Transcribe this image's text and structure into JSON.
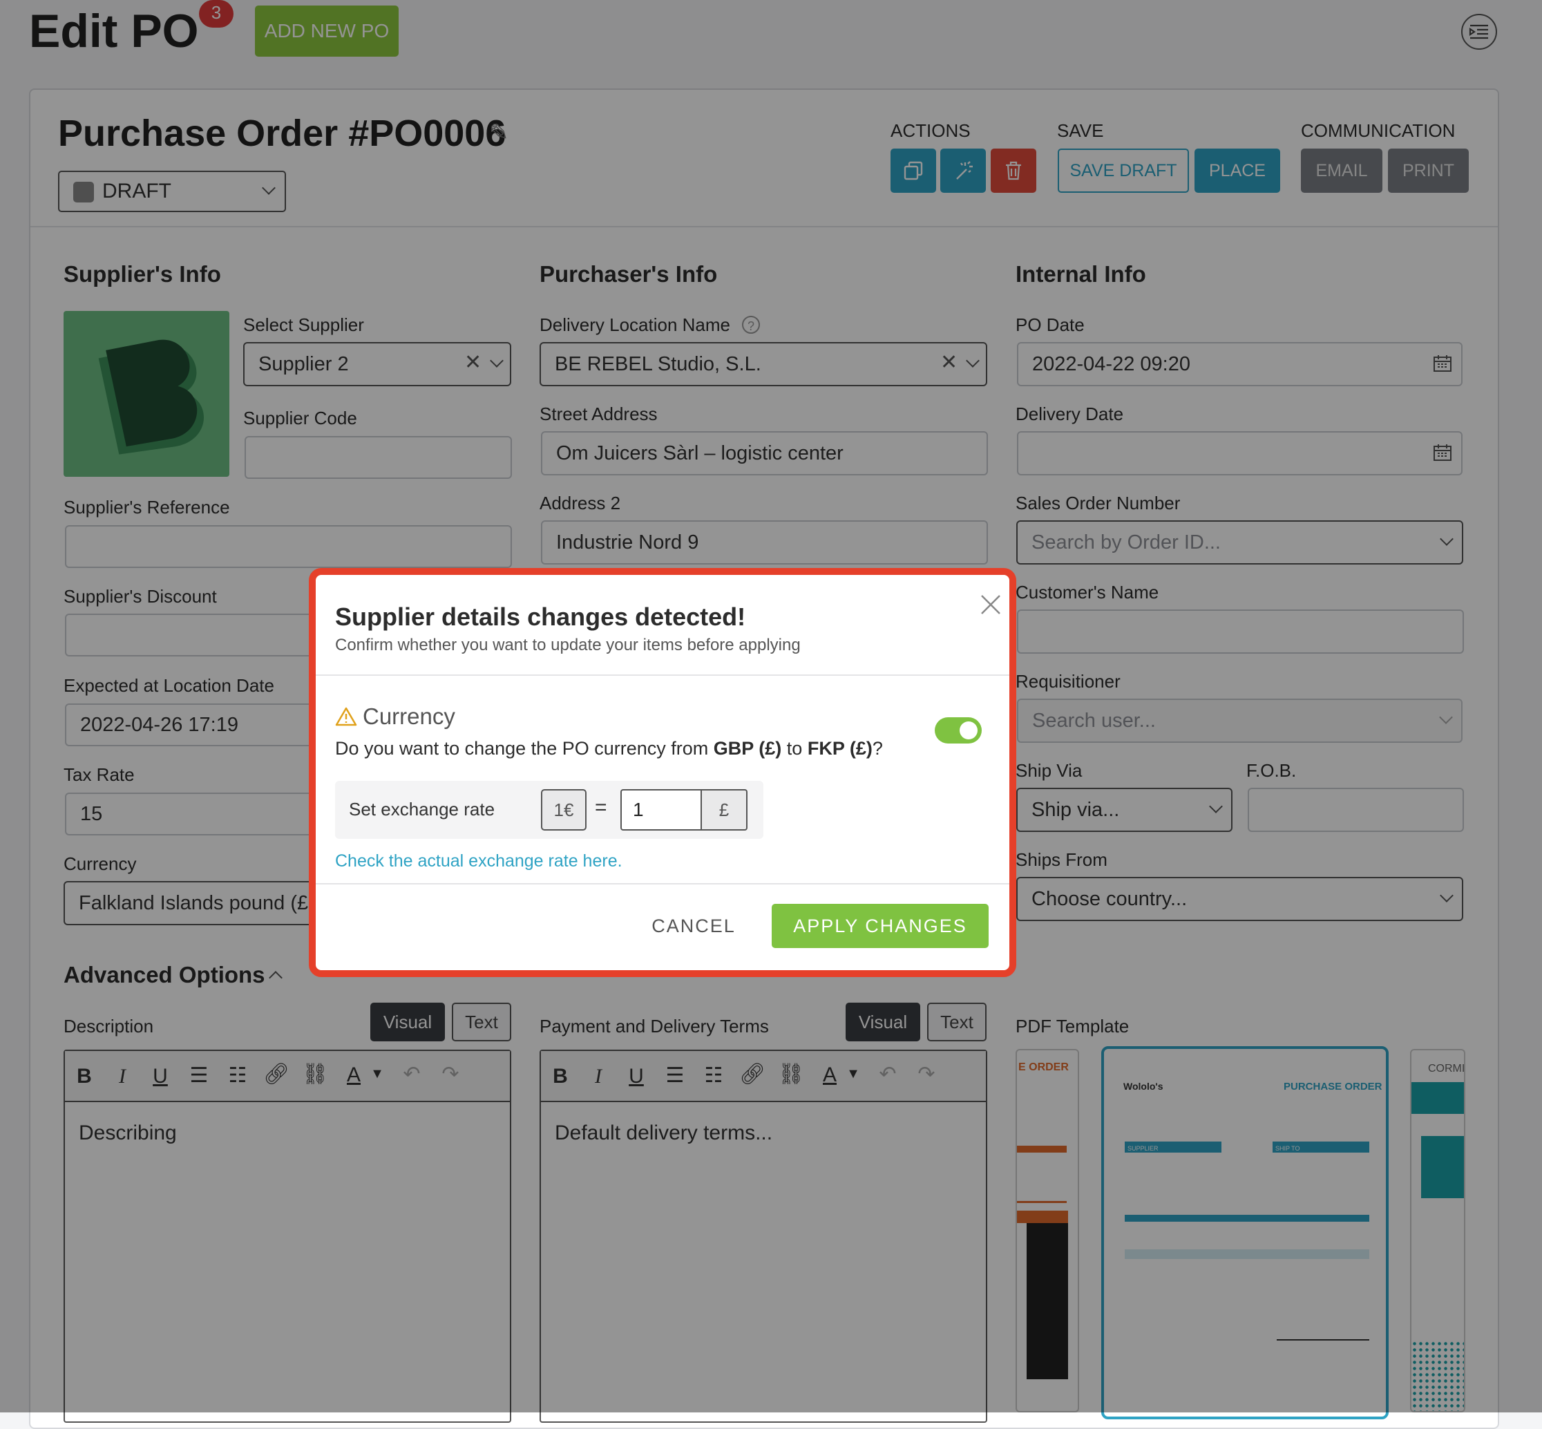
{
  "header": {
    "title": "Edit PO",
    "badge_count": "3",
    "add_new_label": "ADD NEW PO"
  },
  "po": {
    "title": "Purchase Order #PO0006",
    "status": "DRAFT"
  },
  "toolbar": {
    "actions_label": "ACTIONS",
    "save_label": "SAVE",
    "communication_label": "COMMUNICATION",
    "save_draft": "SAVE DRAFT",
    "place": "PLACE",
    "email": "EMAIL",
    "print": "PRINT"
  },
  "supplier": {
    "section_title": "Supplier's Info",
    "select_supplier_label": "Select Supplier",
    "select_supplier_value": "Supplier 2",
    "supplier_code_label": "Supplier Code",
    "supplier_code_value": "",
    "reference_label": "Supplier's Reference",
    "reference_value": "",
    "discount_label": "Supplier's Discount",
    "discount_value": "",
    "expected_date_label": "Expected at Location Date",
    "expected_date_value": "2022-04-26 17:19",
    "tax_rate_label": "Tax Rate",
    "tax_rate_value": "15",
    "currency_label": "Currency",
    "currency_value": "Falkland Islands pound (£"
  },
  "purchaser": {
    "section_title": "Purchaser's Info",
    "delivery_location_label": "Delivery Location Name",
    "delivery_location_value": "BE REBEL Studio, S.L.",
    "street_label": "Street Address",
    "street_value": "Om Juicers Sàrl – logistic center",
    "address2_label": "Address 2",
    "address2_value": "Industrie Nord 9"
  },
  "internal": {
    "section_title": "Internal Info",
    "po_date_label": "PO Date",
    "po_date_value": "2022-04-22 09:20",
    "delivery_date_label": "Delivery Date",
    "delivery_date_value": "",
    "sales_order_label": "Sales Order Number",
    "sales_order_placeholder": "Search by Order ID...",
    "customer_name_label": "Customer's Name",
    "requisitioner_label": "Requisitioner",
    "requisitioner_placeholder": "Search user...",
    "ship_via_label": "Ship Via",
    "ship_via_placeholder": "Ship via...",
    "fob_label": "F.O.B.",
    "ships_from_label": "Ships From",
    "ships_from_placeholder": "Choose country..."
  },
  "advanced": {
    "title": "Advanced Options",
    "description_label": "Description",
    "description_text": "Describing",
    "terms_label": "Payment and Delivery Terms",
    "terms_text": "Default delivery terms...",
    "visual_tab": "Visual",
    "text_tab": "Text",
    "pdf_template_label": "PDF Template"
  },
  "pdf_thumbs": {
    "left_caption": "E ORDER",
    "center_company": "Wololo's",
    "center_title": "PURCHASE ORDER",
    "center_supplier": "SUPPLIER",
    "center_ship_to": "SHIP TO",
    "right_caption": "CORMI"
  },
  "modal": {
    "title": "Supplier details changes detected!",
    "subtitle": "Confirm whether you want to update your items before applying",
    "currency_heading": "Currency",
    "question_prefix": "Do you want to change the PO currency from ",
    "from_currency": "GBP (£)",
    "question_mid": " to ",
    "to_currency": "FKP (£)",
    "question_suffix": "?",
    "toggle_on": true,
    "exchange_label": "Set exchange rate",
    "exchange_base": "1€",
    "equals": "=",
    "exchange_value": "1",
    "exchange_unit": "£",
    "check_rate_link": "Check the actual exchange rate here.",
    "cancel": "CANCEL",
    "apply": "APPLY CHANGES"
  }
}
